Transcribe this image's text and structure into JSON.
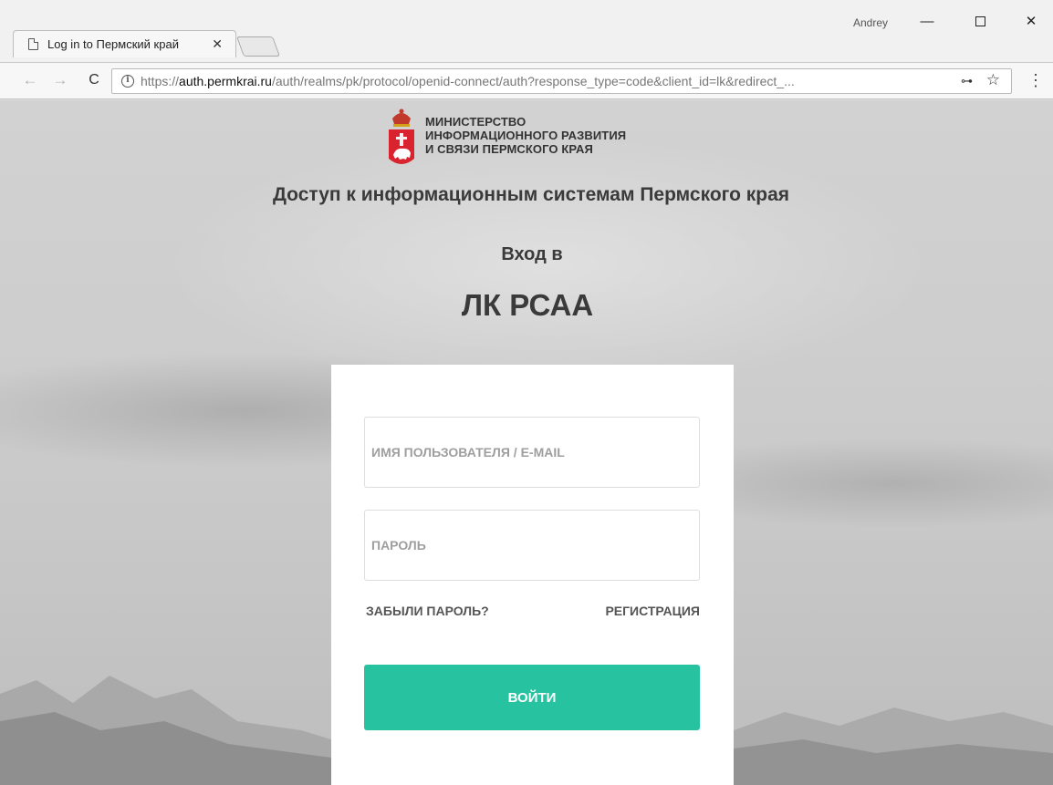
{
  "browser": {
    "tab_title": "Log in to Пермский край",
    "tab_close_icon": "close-icon",
    "user_name": "Andrey",
    "window_controls": {
      "minimize": "—",
      "close": "✕"
    },
    "url_protocol": "https://",
    "url_host": "auth.permkrai.ru",
    "url_path": "/auth/realms/pk/protocol/openid-connect/auth?response_type=code&client_id=lk&redirect_...",
    "icons": {
      "back": "←",
      "forward": "→",
      "reload": "C",
      "info": "i",
      "key": "⊶",
      "star": "☆",
      "menu": "⋮"
    }
  },
  "page": {
    "ministry_lines": [
      "МИНИСТЕРСТВО",
      "ИНФОРМАЦИОННОГО РАЗВИТИЯ",
      "И СВЯЗИ ПЕРМСКОГО КРАЯ"
    ],
    "access_title": "Доступ к информационным системам Пермского края",
    "login_to": "Вход в",
    "system_name": "ЛК РСАА",
    "form": {
      "username_placeholder": "ИМЯ ПОЛЬЗОВАТЕЛЯ / E-MAIL",
      "password_placeholder": "ПАРОЛЬ",
      "forgot_password": "ЗАБЫЛИ ПАРОЛЬ?",
      "register": "РЕГИСТРАЦИЯ",
      "submit": "ВОЙТИ"
    }
  },
  "colors": {
    "accent": "#27c3a1",
    "emblem_red": "#d9232e",
    "emblem_crown": "#c0392b"
  }
}
